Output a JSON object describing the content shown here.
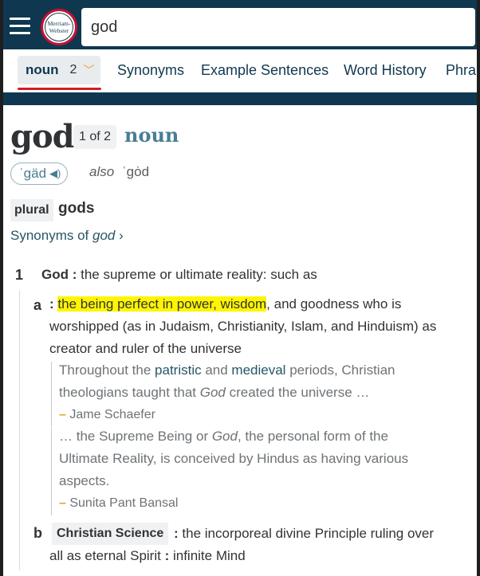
{
  "search": {
    "value": "god"
  },
  "logo": {
    "line1": "Merriam-",
    "line2": "Webster"
  },
  "tabs": {
    "active_label": "noun",
    "active_count": "2",
    "links": [
      "Synonyms",
      "Example Sentences",
      "Word History",
      "Phra"
    ]
  },
  "entry": {
    "headword": "god",
    "count": "1 of 2",
    "pos": "noun",
    "pronunciation": "ˈgäd",
    "also_label": "also",
    "alt_pronunciation": "ˈgȯd",
    "plural_label": "plural",
    "plural_form": "gods",
    "synonyms_link": {
      "prefix": "Synonyms of ",
      "word": "god"
    }
  },
  "sense1": {
    "number": "1",
    "term": "God :",
    "definition": "the supreme or ultimate reality: such as",
    "a": {
      "letter": "a",
      "colon": ":",
      "highlight": "the being perfect in power, wisdom",
      "rest": ", and goodness who is",
      "line2": "worshipped (as in Judaism, Christianity, Islam, and Hinduism) as",
      "line3": "creator and ruler of the universe",
      "quote1": {
        "part1": "Throughout the ",
        "link1": "patristic",
        "part2": " and ",
        "link2": "medieval",
        "part3": " periods, Christian",
        "line2_pre": "theologians taught that ",
        "line2_it": "God",
        "line2_post": " created the universe …",
        "author": "Jame Schaefer"
      },
      "quote2": {
        "line1_pre": "… the Supreme Being or ",
        "line1_it": "God",
        "line1_post": ", the personal form of the",
        "line2": "Ultimate Reality, is conceived by Hindus as having various",
        "line3": "aspects.",
        "author": "Sunita Pant Bansal"
      }
    },
    "b": {
      "letter": "b",
      "label": "Christian Science",
      "colon": ":",
      "definition": "the incorporeal divine Principle ruling over",
      "line2_pre": "all as eternal Spirit ",
      "line2_colon": ":",
      "line2_post": " infinite Mind"
    }
  },
  "colors": {
    "navy": "#0f3850",
    "accent_red": "#d31c24",
    "highlight": "#fff500",
    "link": "#265667"
  }
}
